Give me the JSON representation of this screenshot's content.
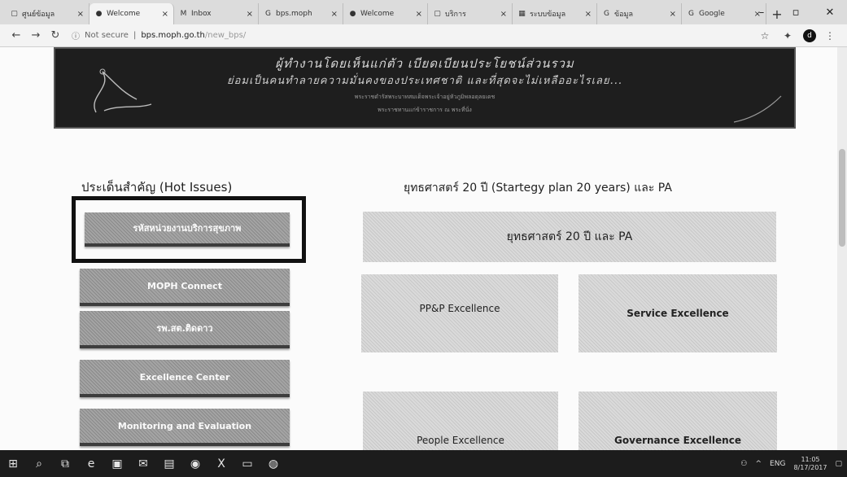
{
  "browser": {
    "tabs": [
      {
        "label": "ศูนย์ข้อมูล",
        "icon": "page-icon"
      },
      {
        "label": "Welcome",
        "icon": "globe-icon"
      },
      {
        "label": "Inbox",
        "icon": "gmail-icon"
      },
      {
        "label": "bps.moph",
        "icon": "google-icon"
      },
      {
        "label": "Welcome",
        "icon": "globe-icon"
      },
      {
        "label": "บริการ",
        "icon": "page-icon"
      },
      {
        "label": "ระบบข้อมูล",
        "icon": "sheet-icon"
      },
      {
        "label": "ข้อมูล",
        "icon": "google-icon"
      },
      {
        "label": "Google",
        "icon": "google-icon"
      }
    ],
    "new_tab": "+",
    "address": {
      "security": "Not secure",
      "host": "bps.moph.go.th",
      "path": "/new_bps/"
    },
    "profile_initial": "d"
  },
  "banner": {
    "line1": "ผู้ทำงานโดยเห็นแก่ตัว เบียดเบียนประโยชน์ส่วนรวม",
    "line2": "ย่อมเป็นคนทำลายความมั่นคงของประเทศชาติ และที่สุดจะไม่เหลืออะไรเลย...",
    "line3": "พระราชดำรัสพระบาทสมเด็จพระเจ้าอยู่หัวภูมิพลอดุลยเดช",
    "line4": "พระราชทานแก่ข้าราชการ ณ พระที่นั่ง"
  },
  "hot_issues": {
    "title": "ประเด็นสำคัญ (Hot Issues)",
    "buttons": [
      "รหัสหน่วยงานบริการสุขภาพ",
      "MOPH Connect",
      "รพ.สต.ติดดาว",
      "Excellence Center",
      "Monitoring and Evaluation"
    ]
  },
  "strategy": {
    "title": "ยุทธศาสตร์ 20 ปี (Startegy plan 20 years) และ PA",
    "main_button": "ยุทธศาสตร์ 20 ปี และ PA",
    "cards": [
      "PP&P Excellence",
      "Service Excellence",
      "People Excellence",
      "Governance Excellence"
    ]
  },
  "taskbar": {
    "lang": "ENG",
    "time": "11:05",
    "date": "8/17/2017"
  }
}
